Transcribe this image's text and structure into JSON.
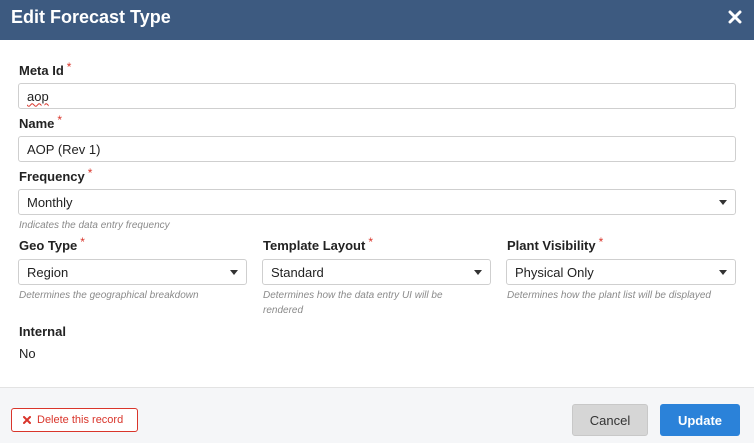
{
  "dialog": {
    "title": "Edit Forecast Type",
    "close_icon": "close-icon"
  },
  "fields": {
    "meta_id": {
      "label": "Meta Id",
      "required": "*",
      "value": "aop"
    },
    "name": {
      "label": "Name",
      "required": "*",
      "value": "AOP (Rev 1)"
    },
    "frequency": {
      "label": "Frequency",
      "required": "*",
      "value": "Monthly",
      "help": "Indicates the data entry frequency"
    },
    "geo_type": {
      "label": "Geo Type",
      "required": "*",
      "value": "Region",
      "help": "Determines the geographical breakdown"
    },
    "template_layout": {
      "label": "Template Layout",
      "required": "*",
      "value": "Standard",
      "help_line1": "Determines how the data entry UI will be",
      "help_line2": "rendered"
    },
    "plant_visibility": {
      "label": "Plant Visibility",
      "required": "*",
      "value": "Physical Only",
      "help": "Determines how the plant list will be displayed"
    },
    "internal": {
      "label": "Internal",
      "value": "No"
    }
  },
  "footer": {
    "delete_label": "Delete this record",
    "cancel_label": "Cancel",
    "update_label": "Update"
  },
  "colors": {
    "header_bg": "#3d5a80",
    "required": "#d9352b",
    "primary": "#2b82d9",
    "danger": "#d9352b"
  }
}
